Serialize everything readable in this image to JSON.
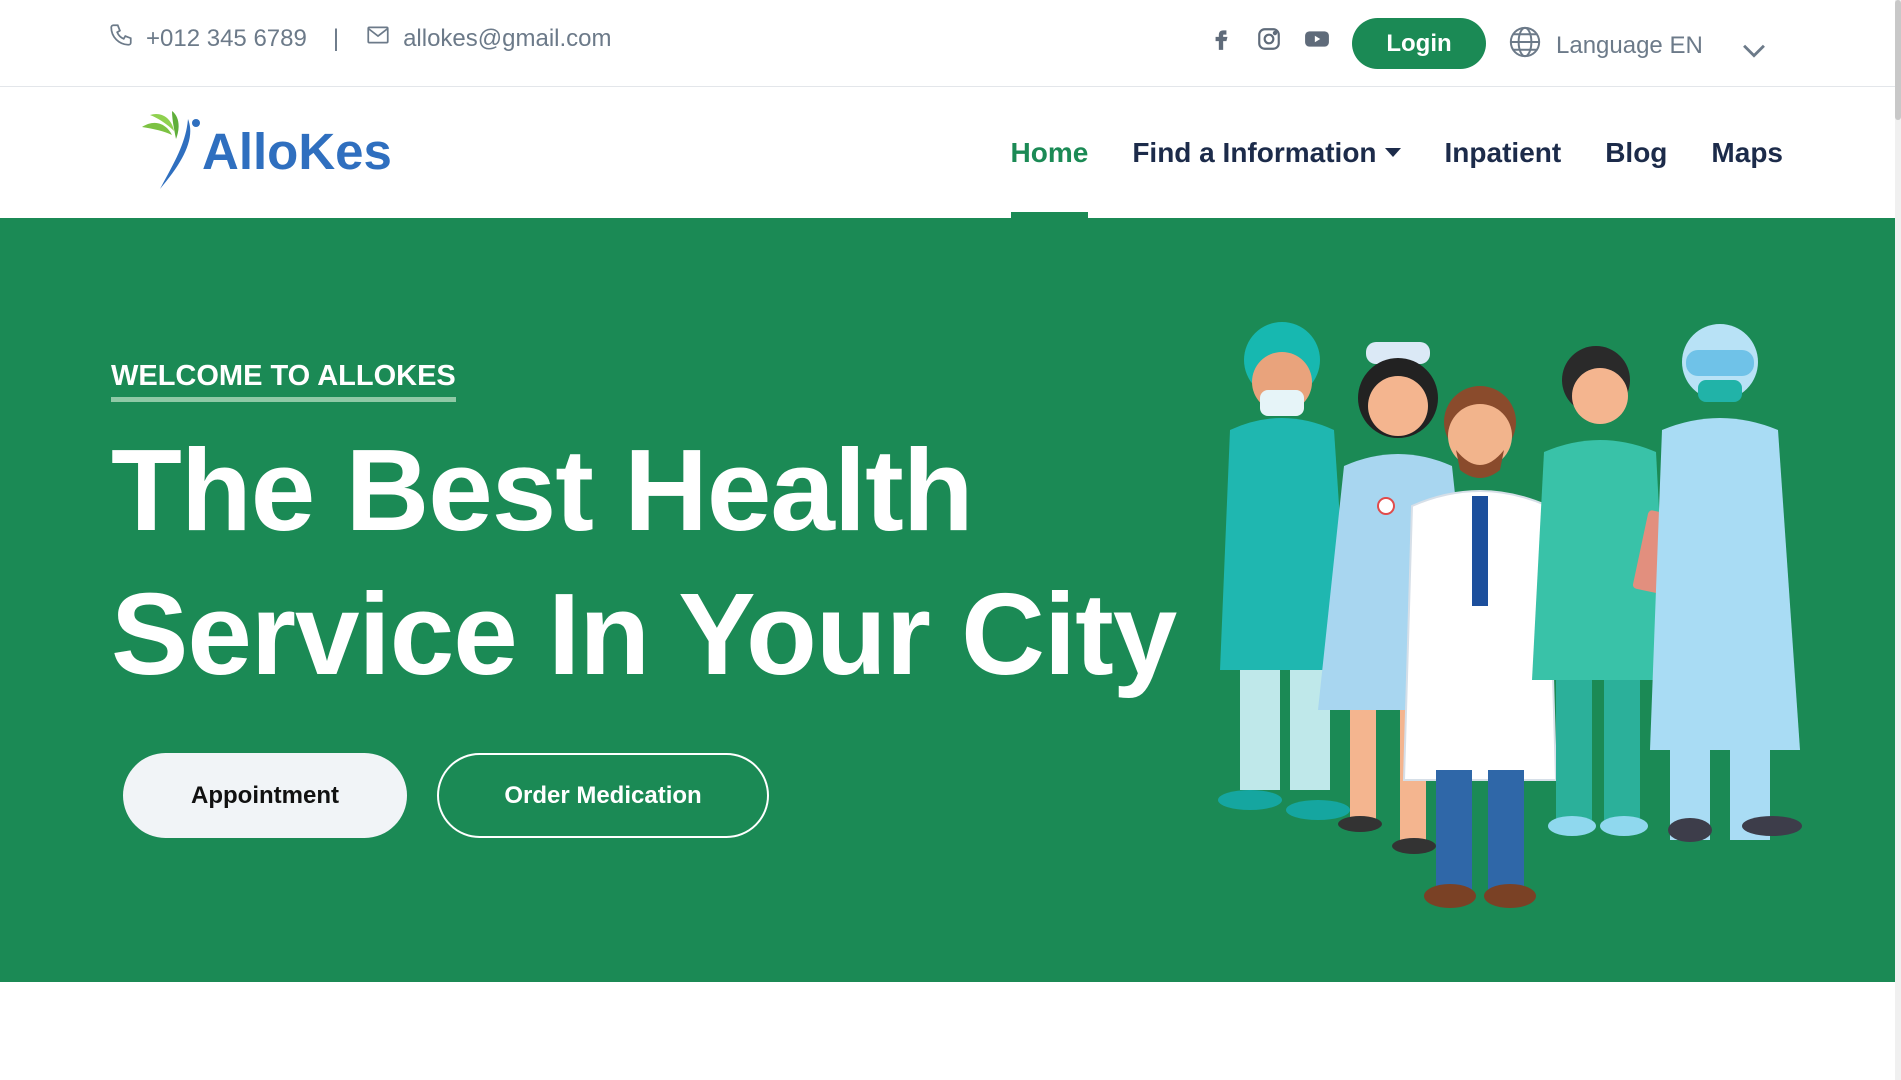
{
  "topbar": {
    "phone": "+012 345 6789",
    "separator": "|",
    "email": "allokes@gmail.com",
    "social_icons": [
      "facebook-icon",
      "instagram-icon",
      "youtube-icon"
    ],
    "login_label": "Login",
    "language_label": "Language EN"
  },
  "navbar": {
    "logo_text": "AlloKes",
    "items": [
      {
        "label": "Home",
        "active": true
      },
      {
        "label": "Find a Information",
        "dropdown": true
      },
      {
        "label": "Inpatient"
      },
      {
        "label": "Blog"
      },
      {
        "label": "Maps"
      }
    ]
  },
  "hero": {
    "eyebrow": "WELCOME TO ALLOKES",
    "headline_line1": "The Best Health",
    "headline_line2": "Service In Your City",
    "primary_button": "Appointment",
    "secondary_button": "Order Medication",
    "illustration": "medical-staff-illustration"
  },
  "colors": {
    "brand_green": "#1b8a55",
    "logo_blue": "#2f6fbf",
    "nav_text": "#1c2b4a",
    "muted_text": "#6c7a89"
  }
}
